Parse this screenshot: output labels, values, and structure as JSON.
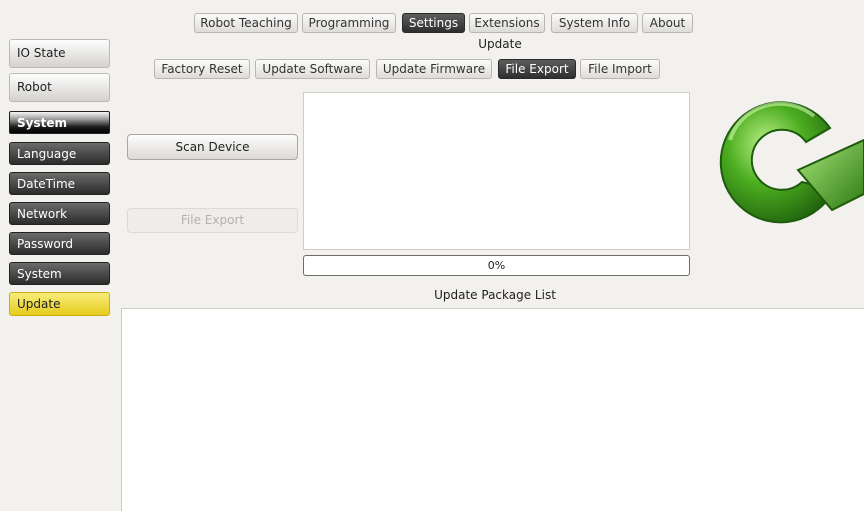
{
  "top_tabs": [
    {
      "label": "Robot Teaching",
      "active": false
    },
    {
      "label": "Programming",
      "active": false
    },
    {
      "label": "Settings",
      "active": true
    },
    {
      "label": "Extensions",
      "active": false
    },
    {
      "label": "System Info",
      "active": false
    },
    {
      "label": "About",
      "active": false
    }
  ],
  "section_title": "Update",
  "sub_tabs": [
    {
      "label": "Factory Reset",
      "active": false
    },
    {
      "label": "Update Software",
      "active": false
    },
    {
      "label": "Update Firmware",
      "active": false
    },
    {
      "label": "File Export",
      "active": true
    },
    {
      "label": "File Import",
      "active": false
    }
  ],
  "sidebar": {
    "io_state": "IO State",
    "robot": "Robot",
    "system_header": "System",
    "items": [
      {
        "label": "Language",
        "active": false
      },
      {
        "label": "DateTime",
        "active": false
      },
      {
        "label": "Network",
        "active": false
      },
      {
        "label": "Password",
        "active": false
      },
      {
        "label": "System",
        "active": false
      },
      {
        "label": "Update",
        "active": true
      }
    ]
  },
  "actions": {
    "scan_device": "Scan Device",
    "file_export": "File Export",
    "file_export_enabled": false
  },
  "progress": {
    "value": 0,
    "label": "0%"
  },
  "package_list": {
    "title": "Update Package List",
    "items": []
  },
  "icons": {
    "update_graphic": "refresh-arrow-icon"
  },
  "colors": {
    "accent_active": "#2e2e2e",
    "selected_yellow": "#e6cc1c",
    "refresh_green": "#3f9a1c"
  }
}
